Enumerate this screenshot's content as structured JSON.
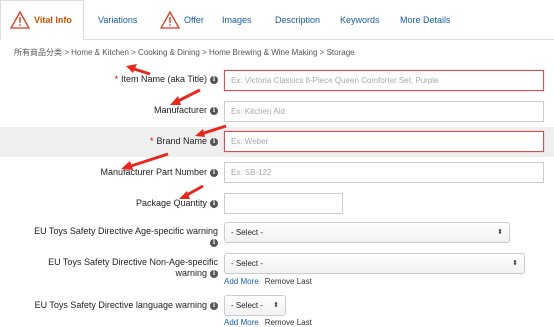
{
  "tabs": [
    {
      "label": "Vital Info",
      "active": true,
      "warning": true
    },
    {
      "label": "Variations",
      "active": false,
      "warning": false
    },
    {
      "label": "Offer",
      "active": false,
      "warning": true
    },
    {
      "label": "Images",
      "active": false,
      "warning": false
    },
    {
      "label": "Description",
      "active": false,
      "warning": false
    },
    {
      "label": "Keywords",
      "active": false,
      "warning": false
    },
    {
      "label": "More Details",
      "active": false,
      "warning": false
    }
  ],
  "breadcrumb": "所有商品分类 > Home & Kitchen > Cooking & Dining > Home Brewing & Wine Making > Storage",
  "fields": {
    "item_name": {
      "label": "Item Name (aka Title)",
      "required": true,
      "placeholder": "Ex: Victoria Classics 8-Piece Queen Comforter Set, Purple"
    },
    "manufacturer": {
      "label": "Manufacturer",
      "required": false,
      "placeholder": "Ex: Kitchen Aid"
    },
    "brand_name": {
      "label": "Brand Name",
      "required": true,
      "placeholder": "Ex: Weber"
    },
    "part_number": {
      "label": "Manufacturer Part Number",
      "required": false,
      "placeholder": "Ex: SB-122"
    },
    "package_quantity": {
      "label": "Package Quantity",
      "required": false,
      "value": ""
    },
    "eu_age": {
      "label": "EU Toys Safety Directive Age-specific warning",
      "value": "- Select -"
    },
    "eu_non_age": {
      "label": "EU Toys Safety Directive Non-Age-specific warning",
      "value": "- Select -"
    },
    "eu_language": {
      "label": "EU Toys Safety Directive language warning",
      "value": "- Select -"
    }
  },
  "links": {
    "add_more": "Add More",
    "remove_last": "Remove Last"
  },
  "info_glyph": "i",
  "required_marker": "*",
  "colors": {
    "link": "#1a5fa3",
    "required": "#c40000",
    "error_border": "#d65050",
    "arrow": "#e8281e"
  }
}
